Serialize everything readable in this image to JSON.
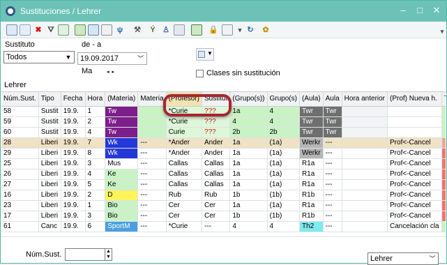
{
  "window": {
    "title": "Sustituciones / Lehrer",
    "min_glyph": "–",
    "max_glyph": "□",
    "close_glyph": "✕"
  },
  "toolbar": {
    "icons": [
      "grid-icon",
      "list-icon",
      "delete-icon",
      "filter-icon",
      "export-icon",
      "assign-icon",
      "notes-icon",
      "table-icon",
      "wifi-icon",
      "tool-icon",
      "sparkle-icon",
      "people-icon",
      "calendar-icon",
      "edit-icon",
      "lock-icon",
      "print-icon",
      "dropdown-icon",
      "refresh-icon",
      "settings-icon"
    ],
    "overflow_glyph": "▾"
  },
  "filters": {
    "substitute_label": "Sustituto",
    "substitute_value": "Todos",
    "date_label": "de - a",
    "date_value": "19.09.2017",
    "day_label": "Ma",
    "view_glyph": "▼",
    "checkbox_label": "Clases sin sustitución",
    "section_label": "Lehrer"
  },
  "grid": {
    "columns": [
      "Núm.Sust.",
      "Tipo",
      "Fecha",
      "Hora",
      "(Materia)",
      "Materia",
      "(Profesor)",
      "Sustitut",
      "(Grupo(s))",
      "Grupo(s)",
      "(Aula)",
      "Aula",
      "Hora anterior",
      "(Prof) Nueva h.",
      "Texto"
    ],
    "rows": [
      [
        "58",
        "Sustit",
        "19.9.",
        "1",
        "Tw",
        "",
        "*Curie",
        "???",
        "1a",
        "4",
        "Twr",
        "Twr",
        "",
        "",
        ""
      ],
      [
        "59",
        "Sustit",
        "19.9.",
        "2",
        "Tw",
        "",
        "*Curie",
        "???",
        "4",
        "4",
        "Twr",
        "Twr",
        "",
        "",
        ""
      ],
      [
        "60",
        "Sustit",
        "19.9.",
        "4",
        "Tw",
        "",
        "Curie",
        "???",
        "2b",
        "2b",
        "Twr",
        "Twr",
        "",
        "",
        ""
      ],
      [
        "28",
        "Liberi",
        "19.9.",
        "7",
        "Wk",
        "---",
        "*Ander",
        "Ander",
        "1a",
        "(1a)",
        "Werkr",
        "---",
        "",
        "Prof<-Cancel",
        ""
      ],
      [
        "29",
        "Liberi",
        "19.9.",
        "8",
        "Wk",
        "---",
        "*Ander",
        "Ander",
        "1a",
        "(1a)",
        "Werkr",
        "---",
        "",
        "Prof<-Cancel",
        ""
      ],
      [
        "25",
        "Liberi",
        "19.9.",
        "3",
        "Mus",
        "---",
        "Callas",
        "Callas",
        "1a",
        "(1a)",
        "R1a",
        "---",
        "",
        "Prof<-Cancel",
        ""
      ],
      [
        "26",
        "Liberi",
        "19.9.",
        "4",
        "Ke",
        "---",
        "Callas",
        "Callas",
        "1a",
        "(1a)",
        "R1a",
        "---",
        "",
        "Prof<-Cancel",
        ""
      ],
      [
        "27",
        "Liberi",
        "19.9.",
        "5",
        "Ke",
        "---",
        "Callas",
        "Callas",
        "1a",
        "(1a)",
        "R1a",
        "---",
        "",
        "Prof<-Cancel",
        ""
      ],
      [
        "16",
        "Liberi",
        "19.9.",
        "2",
        "D",
        "---",
        "Rub",
        "Rub",
        "1b",
        "(1b)",
        "R1b",
        "---",
        "",
        "Prof<-Cancel",
        ""
      ],
      [
        "23",
        "Liberi",
        "19.9.",
        "1",
        "Bio",
        "---",
        "Cer",
        "Cer",
        "1a",
        "(1a)",
        "R1a",
        "---",
        "",
        "Prof<-Cancel",
        ""
      ],
      [
        "17",
        "Liberi",
        "19.9.",
        "3",
        "Bio",
        "---",
        "Cer",
        "Cer",
        "1b",
        "(1b)",
        "R1b",
        "---",
        "",
        "Prof<-Cancel",
        ""
      ],
      [
        "61",
        "Canc",
        "19.9.",
        "6",
        "SportM",
        "---",
        "*Curie",
        "---",
        "4",
        "4",
        "Th2",
        "---",
        "",
        "Cancelación cla",
        ""
      ]
    ]
  },
  "footer": {
    "num_label": "Núm.Sust.",
    "spin_value": "",
    "view_select": "Lehrer"
  },
  "colors": {
    "titlebar": "#6cc2b6",
    "highlight_ring": "#a8262f",
    "purple": "#7c1f8a",
    "blue_wk": "#2438d6",
    "light_green": "#c9f3c4",
    "gray_room": "#6f6f6f",
    "tan_row": "#efe2c5",
    "pink_text": "#f27474"
  }
}
